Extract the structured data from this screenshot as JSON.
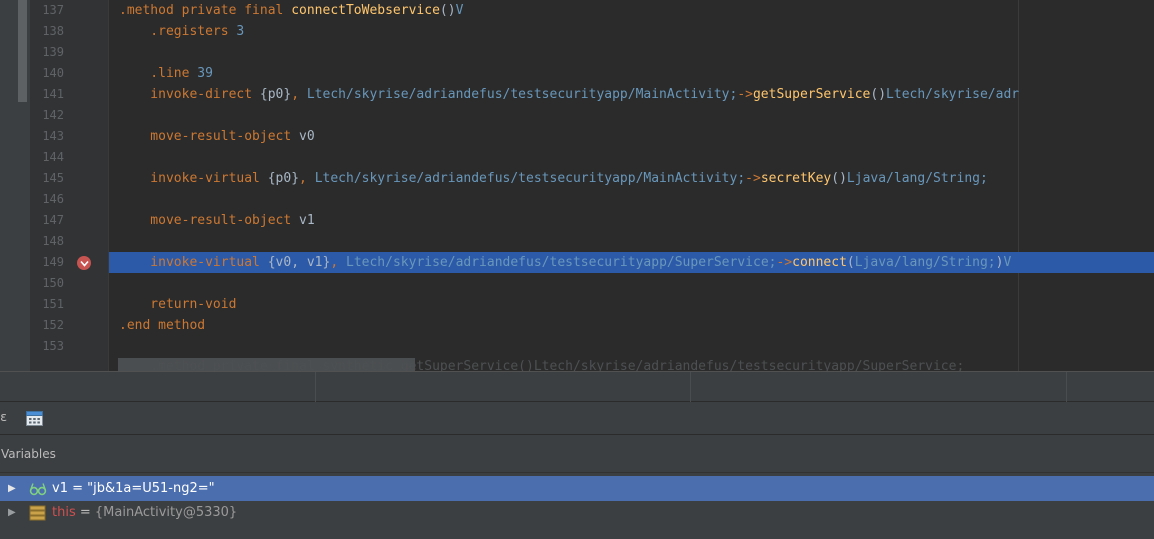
{
  "editor": {
    "lines": [
      {
        "num": "137",
        "tokens": [
          {
            "t": ".method private final ",
            "c": "kw"
          },
          {
            "t": "connectToWebservice",
            "c": "fn"
          },
          {
            "t": "()",
            "c": "plain"
          },
          {
            "t": "V",
            "c": "typ"
          }
        ]
      },
      {
        "num": "138",
        "tokens": [
          {
            "t": "    .registers ",
            "c": "kw"
          },
          {
            "t": "3",
            "c": "num"
          }
        ]
      },
      {
        "num": "139",
        "tokens": []
      },
      {
        "num": "140",
        "tokens": [
          {
            "t": "    .line ",
            "c": "kw"
          },
          {
            "t": "39",
            "c": "num"
          }
        ]
      },
      {
        "num": "141",
        "tokens": [
          {
            "t": "    invoke-direct ",
            "c": "kw"
          },
          {
            "t": "{p0}",
            "c": "plain"
          },
          {
            "t": ", ",
            "c": "kw"
          },
          {
            "t": "Ltech/skyrise/adriandefus/testsecurityapp/MainActivity;",
            "c": "typ"
          },
          {
            "t": "->",
            "c": "kw"
          },
          {
            "t": "getSuperService",
            "c": "fn"
          },
          {
            "t": "()",
            "c": "plain"
          },
          {
            "t": "Ltech/skyrise/adr",
            "c": "typ"
          }
        ]
      },
      {
        "num": "142",
        "tokens": []
      },
      {
        "num": "143",
        "tokens": [
          {
            "t": "    move-result-object ",
            "c": "kw"
          },
          {
            "t": "v0",
            "c": "plain"
          }
        ]
      },
      {
        "num": "144",
        "tokens": []
      },
      {
        "num": "145",
        "tokens": [
          {
            "t": "    invoke-virtual ",
            "c": "kw"
          },
          {
            "t": "{p0}",
            "c": "plain"
          },
          {
            "t": ", ",
            "c": "kw"
          },
          {
            "t": "Ltech/skyrise/adriandefus/testsecurityapp/MainActivity;",
            "c": "typ"
          },
          {
            "t": "->",
            "c": "kw"
          },
          {
            "t": "secretKey",
            "c": "fn"
          },
          {
            "t": "()",
            "c": "plain"
          },
          {
            "t": "Ljava/lang/String;",
            "c": "typ"
          }
        ]
      },
      {
        "num": "146",
        "tokens": []
      },
      {
        "num": "147",
        "tokens": [
          {
            "t": "    move-result-object ",
            "c": "kw"
          },
          {
            "t": "v1",
            "c": "plain"
          }
        ]
      },
      {
        "num": "148",
        "tokens": []
      },
      {
        "num": "149",
        "current": true,
        "tokens": [
          {
            "t": "    invoke-virtual ",
            "c": "kw"
          },
          {
            "t": "{v0, v1}",
            "c": "plain"
          },
          {
            "t": ", ",
            "c": "kw"
          },
          {
            "t": "Ltech/skyrise/adriandefus/testsecurityapp/SuperService;",
            "c": "typ"
          },
          {
            "t": "->",
            "c": "kw"
          },
          {
            "t": "connect",
            "c": "fn"
          },
          {
            "t": "(",
            "c": "plain"
          },
          {
            "t": "Ljava/lang/String;",
            "c": "typ"
          },
          {
            "t": ")",
            "c": "plain"
          },
          {
            "t": "V",
            "c": "typ"
          }
        ]
      },
      {
        "num": "150",
        "tokens": []
      },
      {
        "num": "151",
        "tokens": [
          {
            "t": "    return-void",
            "c": "kw"
          }
        ]
      },
      {
        "num": "152",
        "tokens": [
          {
            "t": ".end method",
            "c": "kw"
          }
        ]
      },
      {
        "num": "153",
        "tokens": []
      }
    ],
    "cut_off_line": "    .method private final synthetic getSuperService()Ltech/skyrise/adriandefus/testsecurityapp/SuperService;",
    "breakpoint_line": "149"
  },
  "variables": {
    "title": "Variables",
    "rows": [
      {
        "name": "v1",
        "eq": " = ",
        "value": "\"jb&1a=U51-ng2=\"",
        "icon": "watch-glasses-icon",
        "selected": true
      },
      {
        "name": "this",
        "eq": " = ",
        "value": "{MainActivity@5330}",
        "icon": "object-fields-icon",
        "selected": false
      }
    ]
  },
  "toolbar": {
    "edge_glyph": "ɛ",
    "icon": "evaluate-expression-icon"
  },
  "colors": {
    "background": "#2b2b2b",
    "keyword": "#cc7832",
    "function": "#ffc66d",
    "type": "#6897bb",
    "current_line": "#2d5aa8",
    "selection": "#4b6eaf",
    "breakpoint": "#c75450"
  }
}
